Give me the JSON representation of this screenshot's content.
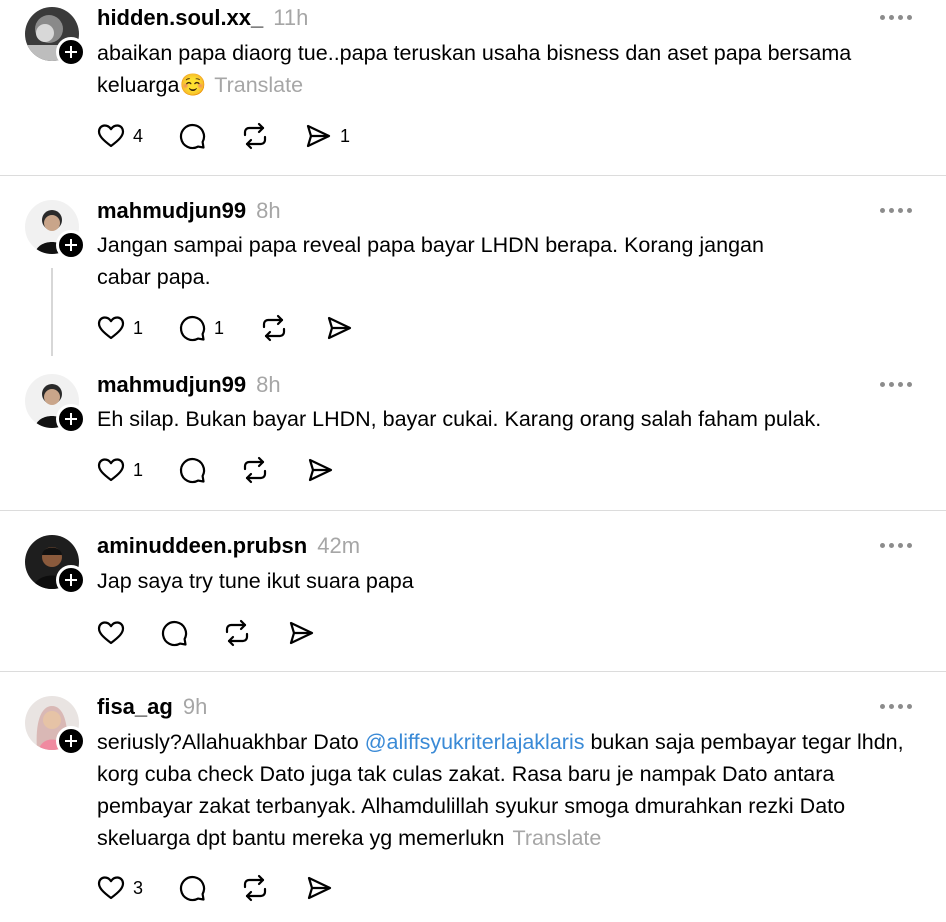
{
  "posts": [
    {
      "username": "hidden.soul.xx_",
      "time": "11h",
      "text": "abaikan papa diaorg tue..papa teruskan usaha bisness dan aset papa bersama keluarga☺️",
      "translate": "Translate",
      "like_count": "4",
      "reply_count": "",
      "share_count": "1"
    },
    {
      "username": "mahmudjun99",
      "time": "8h",
      "text": "Jangan sampai papa reveal papa bayar LHDN berapa. Korang jangan cabar papa.",
      "like_count": "1",
      "reply_count": "1",
      "share_count": ""
    },
    {
      "username": "mahmudjun99",
      "time": "8h",
      "text": "Eh silap. Bukan bayar LHDN, bayar cukai. Karang orang salah faham pulak.",
      "like_count": "1",
      "reply_count": "",
      "share_count": ""
    },
    {
      "username": "aminuddeen.prubsn",
      "time": "42m",
      "text": "Jap saya try tune ikut suara papa",
      "like_count": "",
      "reply_count": "",
      "share_count": ""
    },
    {
      "username": "fisa_ag",
      "time": "9h",
      "text_before": "seriusly?Allahuakhbar Dato ",
      "mention": "@aliffsyukriterlajaklaris",
      "text_after": " bukan saja pembayar tegar lhdn, korg cuba check Dato juga tak culas zakat. Rasa baru je nampak Dato antara pembayar zakat terbanyak. Alhamdulillah syukur smoga dmurahkan rezki Dato skeluarga dpt bantu mereka yg memerlukn",
      "translate": "Translate",
      "like_count": "3",
      "reply_count": "",
      "share_count": ""
    }
  ],
  "icons": {
    "like": "heart-icon",
    "reply": "comment-icon",
    "repost": "repost-icon",
    "share": "send-icon",
    "more": "more-icon",
    "follow": "plus-icon"
  },
  "colors": {
    "muted": "#a6a6a6",
    "mention": "#3a8ad6",
    "divider": "#dcdcdc"
  }
}
